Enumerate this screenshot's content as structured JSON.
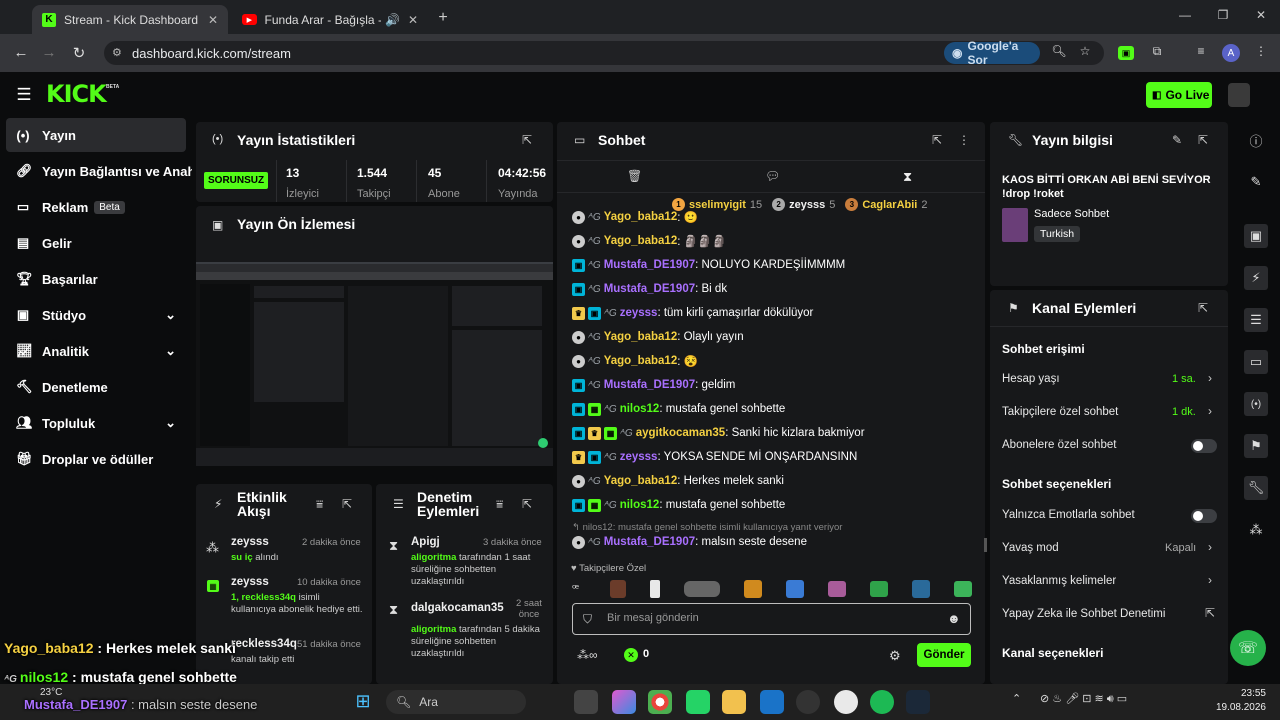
{
  "browser": {
    "tabs": [
      {
        "title": "Stream - Kick Dashboard"
      },
      {
        "title": "Funda Arar - Bağışla - YouTu"
      }
    ],
    "url": "dashboard.kick.com/stream",
    "ask_google": "Google'a Sor",
    "profile_initial": "A"
  },
  "header": {
    "logo": "KICK",
    "logo_badge": "BETA",
    "go_live": "Go Live"
  },
  "sidebar": {
    "items": [
      {
        "label": "Yayın",
        "icon": "broadcast-icon"
      },
      {
        "label": "Yayın Bağlantısı ve Anahtarı",
        "icon": "link-icon"
      },
      {
        "label": "Reklam",
        "icon": "ad-icon",
        "badge": "Beta"
      },
      {
        "label": "Gelir",
        "icon": "revenue-icon"
      },
      {
        "label": "Başarılar",
        "icon": "trophy-icon"
      },
      {
        "label": "Stüdyo",
        "icon": "studio-icon"
      },
      {
        "label": "Analitik",
        "icon": "analytics-icon"
      },
      {
        "label": "Denetleme",
        "icon": "moderation-icon"
      },
      {
        "label": "Topluluk",
        "icon": "community-icon"
      },
      {
        "label": "Droplar ve ödüller",
        "icon": "drops-icon"
      }
    ]
  },
  "stats": {
    "title": "Yayın İstatistikleri",
    "status": "SORUNSUZ",
    "items": [
      {
        "value": "13",
        "label": "İzleyici"
      },
      {
        "value": "1.544",
        "label": "Takipçi"
      },
      {
        "value": "45",
        "label": "Abone"
      },
      {
        "value": "04:42:56",
        "label": "Yayında"
      }
    ]
  },
  "preview": {
    "title": "Yayın Ön İzlemesi"
  },
  "activity": {
    "title": "Etkinlik Akışı",
    "events": [
      {
        "user": "zeysss",
        "detail": "su iç",
        "detail2": " alındı",
        "time": "2 dakika önce"
      },
      {
        "user": "zeysss",
        "detail": "1, reckless34q",
        "detail2": " isimli kullanıcıya abonelik hediye etti.",
        "time": "10 dakika önce"
      },
      {
        "user": "reckless34q",
        "detail": "",
        "detail2": "kanalı takip etti",
        "time": "51 dakika önce"
      }
    ]
  },
  "modlog": {
    "title": "Denetim Eylemleri",
    "actions": [
      {
        "user": "Apigj",
        "by": "aligoritma",
        "text": " tarafından 1 saat süreliğine sohbetten uzaklaştırıldı",
        "time": "3 dakika önce"
      },
      {
        "user": "dalgakocaman35",
        "by": "aligoritma",
        "text": " tarafından 5 dakika süreliğine sohbetten uzaklaştırıldı",
        "time": "2 saat önce"
      }
    ]
  },
  "chat": {
    "title": "Sohbet",
    "top_gifters": [
      {
        "rank": "1",
        "name": "sselimyigit",
        "count": "15"
      },
      {
        "rank": "2",
        "name": "zeysss",
        "count": "5"
      },
      {
        "rank": "3",
        "name": "CaglarAbii",
        "count": "2"
      }
    ],
    "messages": [
      {
        "user": "Yago_baba12",
        "text": ": 🙂",
        "color": "yellow",
        "badges": [
          "circle"
        ]
      },
      {
        "user": "Yago_baba12",
        "text": ": 🗿🗿🗿",
        "color": "yellow",
        "badges": [
          "circle"
        ]
      },
      {
        "user": "Mustafa_DE1907",
        "text": ": NOLUYO KARDEŞİİMMMM",
        "color": "purple",
        "badges": [
          "mod"
        ]
      },
      {
        "user": "Mustafa_DE1907",
        "text": ": Bi dk",
        "color": "purple",
        "badges": [
          "mod"
        ]
      },
      {
        "user": "zeysss",
        "text": ": tüm kirli çamaşırlar dökülüyor",
        "color": "purple",
        "badges": [
          "crown",
          "mod"
        ]
      },
      {
        "user": "Yago_baba12",
        "text": ": Olaylı yayın",
        "color": "yellow",
        "badges": [
          "circle"
        ]
      },
      {
        "user": "Yago_baba12",
        "text": ": 😵",
        "color": "yellow",
        "badges": [
          "circle"
        ]
      },
      {
        "user": "Mustafa_DE1907",
        "text": ": geldim",
        "color": "purple",
        "badges": [
          "mod"
        ]
      },
      {
        "user": "nilos12",
        "text": ": mustafa genel sohbette",
        "color": "green",
        "badges": [
          "mod",
          "gift"
        ]
      },
      {
        "user": "aygitkocaman35",
        "text": ": Sanki hic kizlara bakmiyor",
        "color": "yellow",
        "badges": [
          "mod",
          "crown",
          "gift"
        ]
      },
      {
        "user": "zeysss",
        "text": ": YOKSA SENDE Mİ ONŞARDANSINN",
        "color": "purple",
        "badges": [
          "crown",
          "mod"
        ]
      },
      {
        "user": "Yago_baba12",
        "text": ": Herkes melek sanki",
        "color": "yellow",
        "badges": [
          "circle"
        ]
      },
      {
        "user": "nilos12",
        "text": ": mustafa genel sohbette",
        "color": "green",
        "badges": [
          "mod",
          "gift"
        ]
      }
    ],
    "reply_hint": "nilos12: mustafa genel sohbette isimli kullanıcıya yanıt veriyor",
    "last_message": {
      "user": "Mustafa_DE1907",
      "text": ": malsın seste desene"
    },
    "followers_only": "Takipçilere Özel",
    "input_placeholder": "Bir mesaj gönderin",
    "points": "0",
    "send": "Gönder"
  },
  "info": {
    "title": "Yayın bilgisi",
    "stream_title": "KAOS BİTTİ ORKAN ABİ BENİ SEVİYOR !drop !roket",
    "category": "Sadece Sohbet",
    "language": "Turkish"
  },
  "channel": {
    "title": "Kanal Eylemleri",
    "chat_access": "Sohbet erişimi",
    "account_age": {
      "label": "Hesap yaşı",
      "value": "1 sa."
    },
    "followers_chat": {
      "label": "Takipçilere özel sohbet",
      "value": "1 dk."
    },
    "subs_chat": {
      "label": "Abonelere özel sohbet"
    },
    "chat_options": "Sohbet seçenekleri",
    "emote_only": {
      "label": "Yalnızca Emotlarla sohbet"
    },
    "slow_mode": {
      "label": "Yavaş mod",
      "value": "Kapalı"
    },
    "banned_words": {
      "label": "Yasaklanmış kelimeler"
    },
    "ai_mod": {
      "label": "Yapay Zeka ile Sohbet Denetimi"
    },
    "channel_options": "Kanal seçenekleri"
  },
  "overlay": {
    "lines": [
      {
        "user": "Yago_baba12",
        "text": " : Herkes melek sanki"
      },
      {
        "user": "nilos12",
        "text": " : mustafa genel sohbette"
      },
      {
        "user": "Mustafa_DE1907",
        "text": " : malsın seste desene"
      }
    ]
  },
  "taskbar": {
    "weather": "23°C",
    "search": "Ara",
    "time": "23:55",
    "date": "19.08.2026"
  },
  "colors": {
    "kick_green": "#53fc18",
    "panel": "#17181a",
    "bg": "#0b0c0d"
  }
}
